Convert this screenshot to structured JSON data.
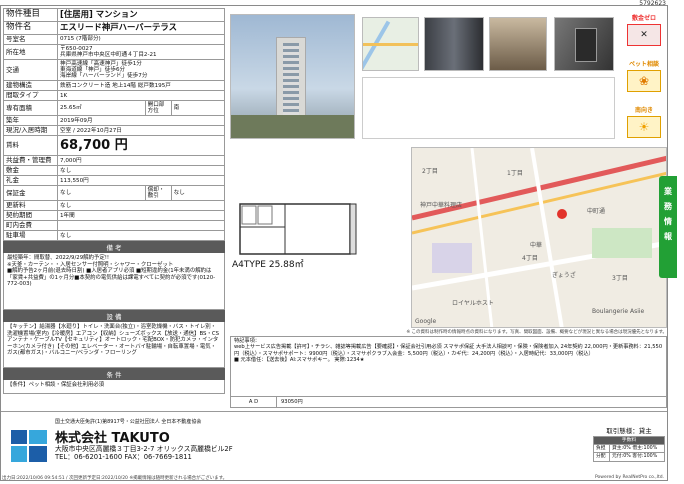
{
  "doc_id": "5792623",
  "rows": [
    {
      "label": "物件種目",
      "value": "[住居用] マンション",
      "kind": "big"
    },
    {
      "label": "物件名",
      "value": "エスリード神戸ハーバーテラス",
      "kind": "big"
    },
    {
      "label": "号室名",
      "value": "0715 (7階部分)"
    },
    {
      "label": "所在地",
      "value": "〒650-0027\n兵庫県神戸市中央区中町通４丁目2-21"
    },
    {
      "label": "交通",
      "value": "神戸高速線「高速神戸」徒歩1分\n東海道線「神戸」徒歩6分\n海岸線「ハーバーランド」徒歩7分"
    },
    {
      "label": "建物構造",
      "value": "鉄筋コンクリート造 地上14階 総戸数195戸"
    },
    {
      "label": "間取タイプ",
      "value": "1K"
    }
  ],
  "area_label": "専有面積",
  "area_value": "25.65㎡",
  "floorplan_dir_label": "開口部方位",
  "direction": "南",
  "rows2": [
    {
      "label": "築年",
      "value": "2019年09月"
    },
    {
      "label": "現況/入居時期",
      "value": "空室 / 2022年10月27日"
    }
  ],
  "rent_label": "賃料",
  "rent_value": "68,700 円",
  "rows3": [
    {
      "label": "共益費・管理費",
      "value": "7,000円"
    },
    {
      "label": "敷金",
      "value": "なし"
    },
    {
      "label": "礼金",
      "value": "113,550円"
    }
  ],
  "deposit_label": "保証金",
  "deposit_value": "なし",
  "shokyaku_label": "償却・敷引",
  "shokyaku_value": "なし",
  "rows4": [
    {
      "label": "更新料",
      "value": "なし"
    },
    {
      "label": "契約期間",
      "value": "1年間"
    },
    {
      "label": "町内会費",
      "value": ""
    },
    {
      "label": "駐車場",
      "value": "なし"
    }
  ],
  "remarks_title": "備 考",
  "remarks": "最短築年：間取替、2022/9/29解約予定!!\n※天釜・カーテン・・入居センサー付照明・シャワー・クローゼット\n■解約予告2ヶ月前(退去時日割)  ■入居者アプリ必須  ■短期違約金(1年未満の解約は「家賃+共益費」の1ヶ月分■本契約の電気供給は課電すべてに契約が必須です(0120-772-003)",
  "equip_title": "設 備",
  "equipment": "【キッチン】給湯器【水廻り】トイレ・洗面台(独立)・浴室乾燥機・バス・トイレ別・洗濯機置場(室内)【冷暖房】エアコン【収納】シューズボックス【放送・通信】BS・CSアンテナ・ケーブルTV【セキュリティ】オートロック・宅配BOX・防犯カメラ・インターホン(カメラ付き)【その他】エレベーター・オートバイ駐輪場・自転車置場・電気・ガス(都市ガス)・バルコニー/ベランダ・フローリング",
  "cond_title": "条 件",
  "conditions": "【条件】ペット相談・保証会社利用必須",
  "badges": {
    "b1": "敷金ゼロ",
    "b2": "ペット相談",
    "b3": "南向き"
  },
  "floorplan_text": "A4TYPE 25.88㎡",
  "map_labels": [
    "2丁目",
    "1丁目",
    "神戸中華料理店",
    "中華",
    "中町通",
    "3丁目",
    "ロイヤルホスト",
    "Boulangerie Asiie",
    "ぎょうざ",
    "4丁目",
    "Google"
  ],
  "disclaimer": "※ この資料は制作時の情報時点の資料になります。写真、間取図面、設備、概要などが現況と異なる場合は現況優先となります。",
  "spec_title": "特記事項：",
  "spec_text": "web上サービス広告掲載【許可】・チラシ、雑誌等掲載広告【要確認】・保証会社引用必須 スマサポ保証 大手法人相談可・保険・保険者加入 24年契約 22,000円・更新事務料：21,550円（税込）・スマサポサポート：9900円（税込）・スマサポクラブ入会金：5,500円（税込）・カギ代：24,200円（税込）・入居時紀代：33,000円（税込）\n■ 元本借任：【送去後】AI:スマサポキー。 実際:1234★",
  "ad_label": "A  D",
  "ad_value": "93050円",
  "side_text": [
    "業",
    "務",
    "情",
    "報"
  ],
  "company": {
    "license": "国土交通大臣免許(1)第8917号・公益社団法人 全日本不動産協会",
    "name": "株式会社 TAKUTO",
    "address": "大阪市中央区高麗橋３丁目3-2-7 オリックス高麗橋ビル2F",
    "tel": "TEL：06-6201-1600  FAX：06-7669-1811"
  },
  "deal": {
    "title": "取引態様：貸主",
    "fee": "手数料",
    "r1": "貸主:0% 借主:100%",
    "r2": "元付:0% 客付:100%",
    "l1": "負担",
    "l2": "分配"
  },
  "bottom_left": "出力日:2022/10/06 09:54:51 / 次回更新予定日:2022/10/20 ※掲載情報は随時更新される場合がございます。",
  "bottom_right": "Powered by RealNetPro co.,ltd."
}
